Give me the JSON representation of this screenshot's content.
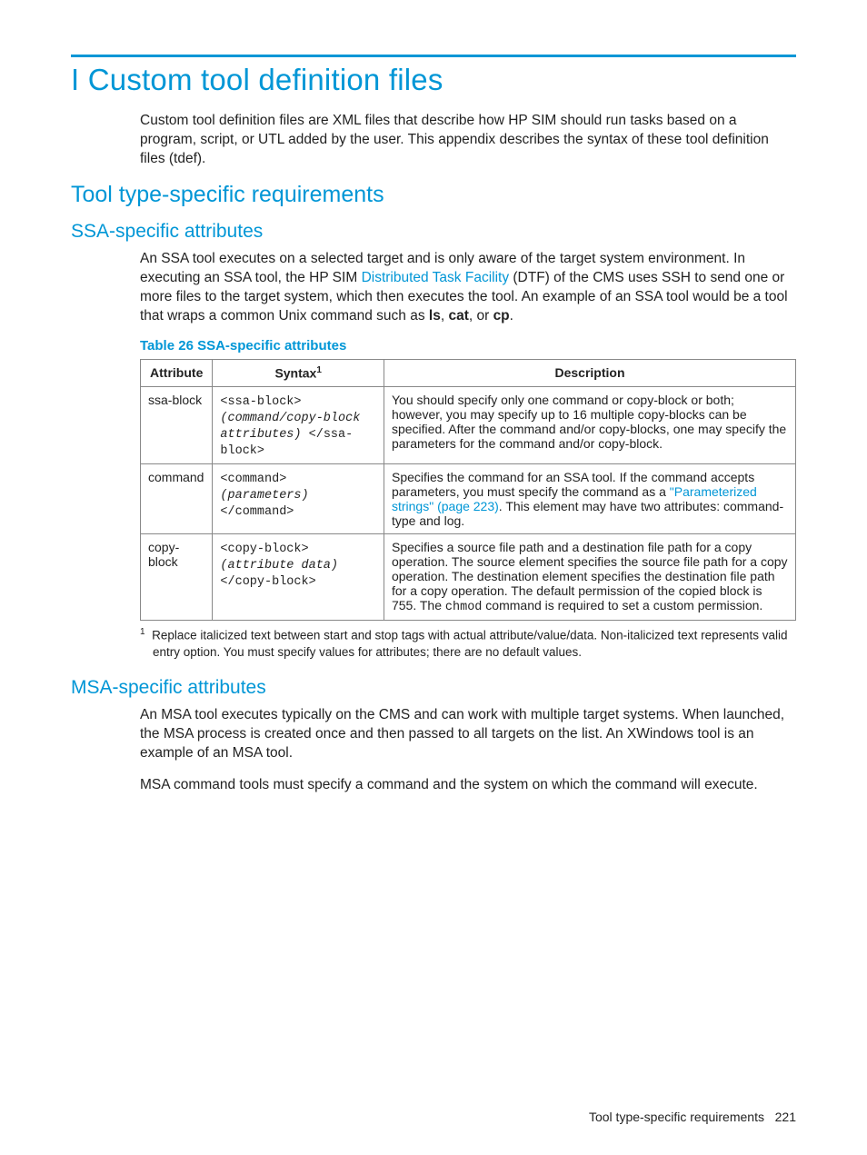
{
  "title": "I Custom tool definition files",
  "intro": "Custom tool definition files are XML files that describe how HP SIM should run tasks based on a program, script, or UTL added by the user. This appendix describes the syntax of these tool definition files (tdef).",
  "h2": "Tool type-specific requirements",
  "ssa": {
    "heading": "SSA-specific attributes",
    "para_pre": "An SSA tool executes on a selected target and is only aware of the target system environment. In executing an SSA tool, the HP SIM ",
    "dtf_link": "Distributed Task Facility",
    "para_mid": " (DTF) of the CMS uses SSH to send one or more files to the target system, which then executes the tool. An example of an SSA tool would be a tool that wraps a common Unix command such as ",
    "cmd1": "ls",
    "cmd2": "cat",
    "cmd3": "cp",
    "table_caption": "Table 26 SSA-specific attributes",
    "th1": "Attribute",
    "th2": "Syntax",
    "th3": "Description",
    "rows": [
      {
        "attr": "ssa-block",
        "syn_tag_open": "<ssa-block> ",
        "syn_param": "(command/copy-block attributes)",
        "syn_tag_close": " </ssa-block>",
        "desc": "You should specify only one command or copy-block or both; however, you may specify up to 16 multiple copy-blocks can be specified. After the command and/or copy-blocks, one may specify the parameters for the command and/or copy-block."
      },
      {
        "attr": "command",
        "syn_tag_open": "<command> ",
        "syn_param": "(parameters)",
        "syn_tag_close": " </command>",
        "desc_pre": "Specifies the command for an SSA tool. If the command accepts parameters, you must specify the command as a ",
        "desc_link": "\"Parameterized strings\" (page 223)",
        "desc_post": ". This element may have two attributes: command-type and log."
      },
      {
        "attr": "copy-block",
        "syn_tag_open": "<copy-block> ",
        "syn_param": "(attribute data)",
        "syn_tag_close": " </copy-block>",
        "desc_pre": "Specifies a source file path and a destination file path for a copy operation. The source element specifies the source file path for a copy operation. The destination element specifies the destination file path for a copy operation. The default permission of the copied block is 755. The ",
        "desc_mono": "chmod",
        "desc_post": " command is required to set a custom permission."
      }
    ],
    "footnote_marker": "1",
    "footnote": "Replace italicized text between start and stop tags with actual attribute/value/data. Non-italicized text represents valid entry option. You must specify values for attributes; there are no default values."
  },
  "msa": {
    "heading": "MSA-specific attributes",
    "para1": "An MSA tool executes typically on the CMS and can work with multiple target systems. When launched, the MSA process is created once and then passed to all targets on the list. An XWindows tool is an example of an MSA tool.",
    "para2": "MSA command tools must specify a command and the system on which the command will execute."
  },
  "footer": {
    "text": "Tool type-specific requirements",
    "page": "221"
  }
}
